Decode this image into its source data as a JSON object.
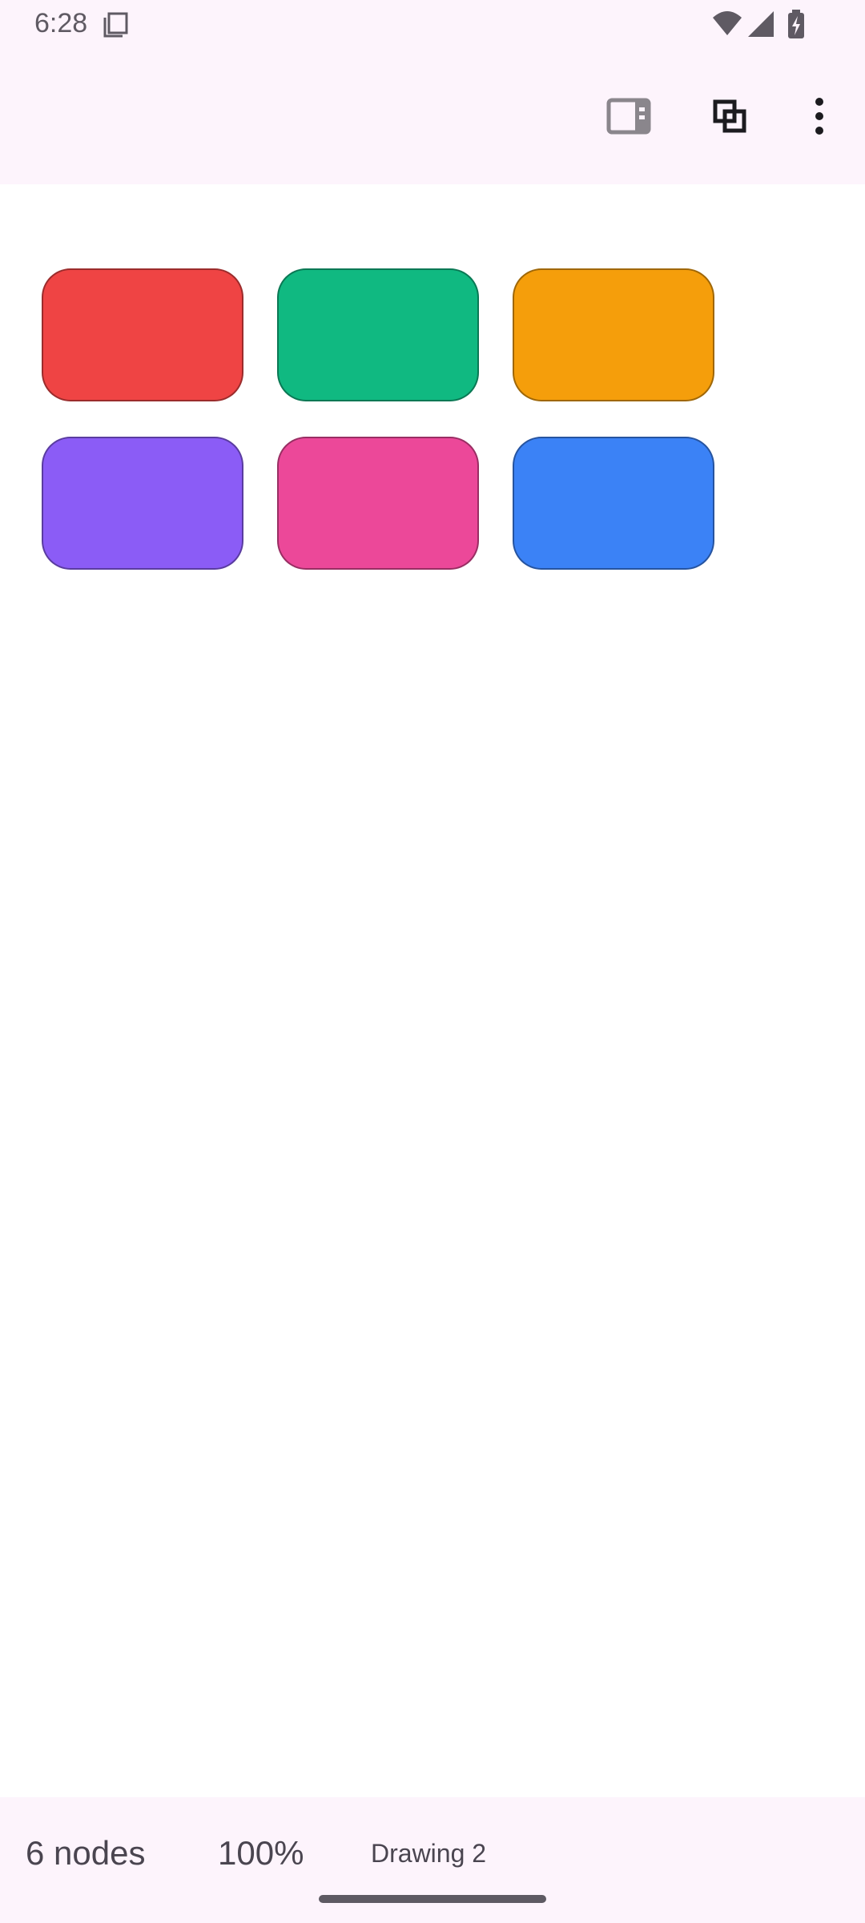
{
  "status_bar": {
    "time": "6:28",
    "icons": [
      "document-icon",
      "wifi-icon",
      "cellular-signal-icon",
      "battery-charging-icon"
    ]
  },
  "app_bar": {
    "actions": [
      {
        "name": "side-panel-icon",
        "label": "Toggle side panel"
      },
      {
        "name": "layers-icon",
        "label": "Layers"
      },
      {
        "name": "more-options-icon",
        "label": "More options"
      }
    ]
  },
  "canvas": {
    "nodes": [
      {
        "color": "#ef4444"
      },
      {
        "color": "#10b981"
      },
      {
        "color": "#f59e0b"
      },
      {
        "color": "#8b5cf6"
      },
      {
        "color": "#ec4899"
      },
      {
        "color": "#3b82f6"
      }
    ]
  },
  "footer": {
    "node_count": "6 nodes",
    "zoom": "100%",
    "drawing_name": "Drawing 2"
  },
  "colors": {
    "bar_background": "#fdf4fc",
    "canvas_background": "#ffffff",
    "text": "#4a4550"
  }
}
